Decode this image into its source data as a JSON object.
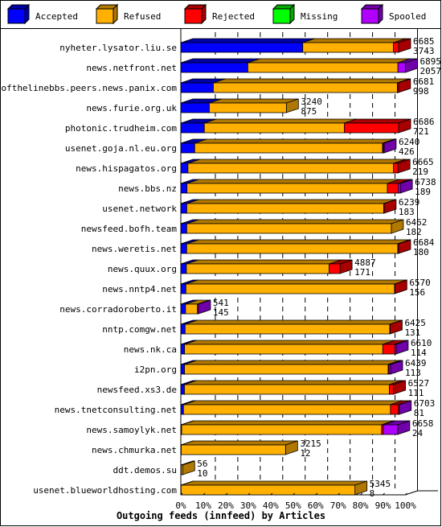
{
  "chart_data": {
    "type": "bar",
    "orientation": "horizontal",
    "stacked": true,
    "style": "3d",
    "title": "Outgoing feeds (innfeed) by Articles",
    "xlabel": "",
    "ylabel": "",
    "xlim": [
      0,
      100
    ],
    "x_ticks": [
      "0%",
      "10%",
      "20%",
      "30%",
      "40%",
      "50%",
      "60%",
      "70%",
      "80%",
      "90%",
      "100%"
    ],
    "grid": true,
    "legend_position": "top",
    "series": [
      {
        "name": "Accepted",
        "color": "#0000ff",
        "side_color": "#0000a8"
      },
      {
        "name": "Refused",
        "color": "#ffb000",
        "side_color": "#b07800"
      },
      {
        "name": "Rejected",
        "color": "#ff0000",
        "side_color": "#a80000"
      },
      {
        "name": "Missing",
        "color": "#00ff00",
        "side_color": "#00a800"
      },
      {
        "name": "Spooled",
        "color": "#b000ff",
        "side_color": "#7000a8"
      }
    ],
    "rows": [
      {
        "host": "nyheter.lysator.liu.se",
        "total": "6685",
        "accepted_label": "3743",
        "values": [
          3743,
          2786,
          156,
          0,
          0
        ]
      },
      {
        "host": "news.netfront.net",
        "total": "6895",
        "accepted_label": "2057",
        "values": [
          2057,
          4608,
          0,
          0,
          230
        ]
      },
      {
        "host": "endofthelinebbs.peers.news.panix.com",
        "total": "6681",
        "accepted_label": "998",
        "values": [
          998,
          5650,
          33,
          0,
          0
        ]
      },
      {
        "host": "news.furie.org.uk",
        "total": "3240",
        "accepted_label": "875",
        "values": [
          875,
          2365,
          0,
          0,
          0
        ]
      },
      {
        "host": "photonic.trudheim.com",
        "total": "6686",
        "accepted_label": "721",
        "values": [
          721,
          4297,
          1668,
          0,
          0
        ]
      },
      {
        "host": "usenet.goja.nl.eu.org",
        "total": "6240",
        "accepted_label": "426",
        "values": [
          426,
          5767,
          20,
          0,
          27
        ]
      },
      {
        "host": "news.hispagatos.org",
        "total": "6665",
        "accepted_label": "219",
        "values": [
          219,
          6312,
          134,
          0,
          0
        ]
      },
      {
        "host": "news.bbs.nz",
        "total": "6738",
        "accepted_label": "189",
        "values": [
          189,
          6152,
          337,
          0,
          60
        ]
      },
      {
        "host": "usenet.network",
        "total": "6239",
        "accepted_label": "183",
        "values": [
          183,
          6046,
          10,
          0,
          0
        ]
      },
      {
        "host": "newsfeed.bofh.team",
        "total": "6462",
        "accepted_label": "182",
        "values": [
          182,
          6280,
          0,
          0,
          0
        ]
      },
      {
        "host": "news.weretis.net",
        "total": "6684",
        "accepted_label": "180",
        "values": [
          180,
          6479,
          25,
          0,
          0
        ]
      },
      {
        "host": "news.quux.org",
        "total": "4887",
        "accepted_label": "171",
        "values": [
          171,
          4384,
          332,
          0,
          0
        ]
      },
      {
        "host": "news.nntp4.net",
        "total": "6570",
        "accepted_label": "156",
        "values": [
          156,
          6404,
          10,
          0,
          0
        ]
      },
      {
        "host": "news.corradoroberto.it",
        "total": "541",
        "accepted_label": "145",
        "values": [
          145,
          366,
          0,
          0,
          30
        ]
      },
      {
        "host": "nntp.comgw.net",
        "total": "6425",
        "accepted_label": "131",
        "values": [
          131,
          6284,
          10,
          0,
          0
        ]
      },
      {
        "host": "news.nk.ca",
        "total": "6610",
        "accepted_label": "114",
        "values": [
          114,
          6085,
          371,
          0,
          40
        ]
      },
      {
        "host": "i2pn.org",
        "total": "6439",
        "accepted_label": "113",
        "values": [
          113,
          6251,
          25,
          0,
          50
        ]
      },
      {
        "host": "newsfeed.xs3.de",
        "total": "6527",
        "accepted_label": "111",
        "values": [
          111,
          6292,
          124,
          0,
          0
        ]
      },
      {
        "host": "news.tnetconsulting.net",
        "total": "6703",
        "accepted_label": "81",
        "values": [
          81,
          6354,
          248,
          0,
          20
        ]
      },
      {
        "host": "news.samoylyk.net",
        "total": "6658",
        "accepted_label": "24",
        "values": [
          24,
          6139,
          50,
          0,
          445
        ]
      },
      {
        "host": "news.chmurka.net",
        "total": "3215",
        "accepted_label": "12",
        "values": [
          12,
          3203,
          0,
          0,
          0
        ]
      },
      {
        "host": "ddt.demos.su",
        "total": "56",
        "accepted_label": "10",
        "values": [
          10,
          46,
          0,
          0,
          0
        ]
      },
      {
        "host": "usenet.blueworldhosting.com",
        "total": "5345",
        "accepted_label": "8",
        "values": [
          8,
          5337,
          0,
          0,
          0
        ]
      }
    ]
  }
}
